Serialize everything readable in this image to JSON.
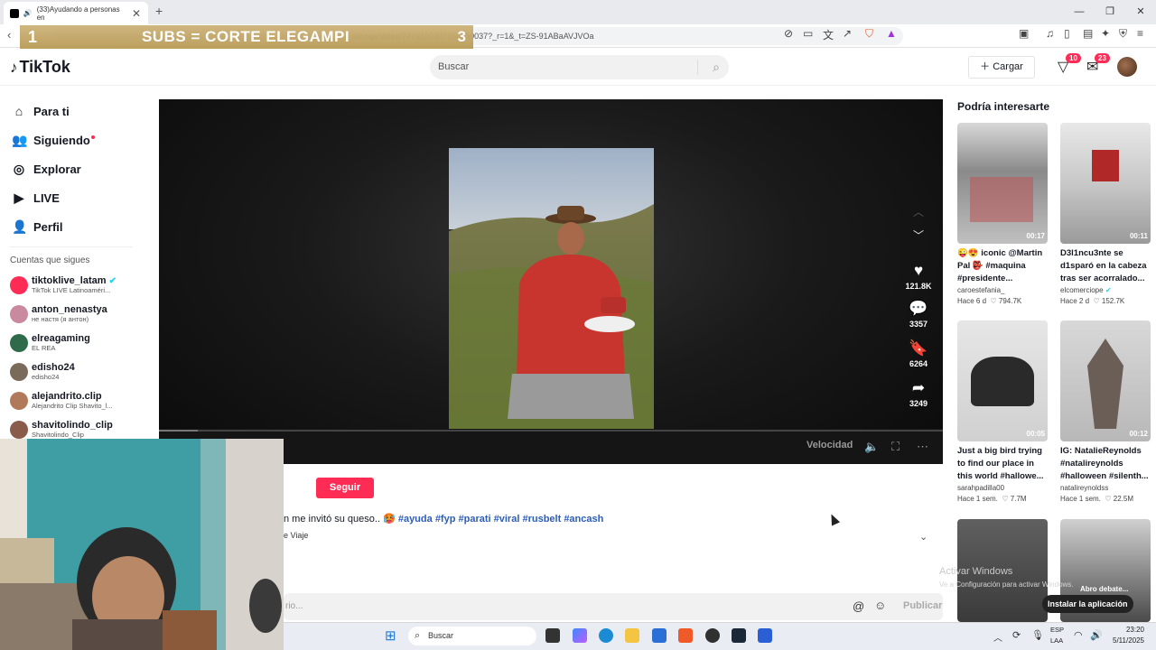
{
  "browser": {
    "tab_title": "(33)Ayudando a personas en",
    "url": "deviaje/video/7479190307366350037?_r=1&_t=ZS-91ABaAVJVOa"
  },
  "overlay": {
    "left": "1",
    "text": "SUBS = CORTE ELEGAMPI",
    "right": "3"
  },
  "header": {
    "logo": "TikTok",
    "search_placeholder": "Buscar",
    "upload_label": "Cargar",
    "inbox_badge": "10",
    "messages_badge": "23"
  },
  "sidebar": {
    "nav": [
      {
        "label": "Para ti",
        "icon": "home-icon"
      },
      {
        "label": "Siguiendo",
        "icon": "following-icon"
      },
      {
        "label": "Explorar",
        "icon": "compass-icon"
      },
      {
        "label": "LIVE",
        "icon": "live-icon"
      },
      {
        "label": "Perfil",
        "icon": "profile-icon"
      }
    ],
    "following_title": "Cuentas que sigues",
    "accounts": [
      {
        "name": "tiktoklive_latam",
        "sub": "TikTok LIVE Latinoaméri..."
      },
      {
        "name": "anton_nenastya",
        "sub": "не настя (я антон)"
      },
      {
        "name": "elreagaming",
        "sub": "EL REA"
      },
      {
        "name": "edisho24",
        "sub": "edisho24"
      },
      {
        "name": "alejandrito.clip",
        "sub": "Alejandrito Clip Shavito_l..."
      },
      {
        "name": "shavitolindo_clip",
        "sub": "Shavitolindo_Clip"
      }
    ]
  },
  "video": {
    "likes": "121.8K",
    "comments": "3357",
    "saves": "6264",
    "shares": "3249",
    "speed_label": "Velocidad",
    "progress": 0.05
  },
  "post": {
    "follow_label": "Seguir",
    "desc_text": "n me invitó su queso.. 🥵",
    "hashtags": [
      "#ayuda",
      "#fyp",
      "#parati",
      "#viral",
      "#rusbelt",
      "#ancash"
    ],
    "music": "e Viaje",
    "comment_placeholder": "rio...",
    "publish_label": "Publicar"
  },
  "recommendations": {
    "title": "Podría interesarte",
    "cards": [
      {
        "title": "😜😍 iconic @Martin Pal 👺 #maquina #presidente...",
        "author": "caroestefania_",
        "age": "Hace 6 d",
        "likes": "794.7K",
        "duration": "00:17"
      },
      {
        "title": "D3l1ncu3nte se d1sparó en la cabeza tras ser acorralado...",
        "author": "elcomerciope",
        "age": "Hace 2 d",
        "likes": "152.7K",
        "duration": "00:11"
      },
      {
        "title": "Just a big bird trying to find our place in this world #hallowe...",
        "author": "sarahpadilla00",
        "age": "Hace 1 sem.",
        "likes": "7.7M",
        "duration": "00:05"
      },
      {
        "title": "IG: NatalieReynolds #natalireynolds #halloween #silenth...",
        "author": "natalireynoldss",
        "age": "Hace 1 sem.",
        "likes": "22.5M",
        "duration": "00:12"
      }
    ],
    "partial_label": "Abro debate..."
  },
  "misc": {
    "activate_title": "Activar Windows",
    "activate_sub": "Ve a Configuración para activar Windows.",
    "install_app": "Instalar la aplicación"
  },
  "taskbar": {
    "search_label": "Buscar",
    "lang_line1": "ESP",
    "lang_line2": "LAA",
    "time": "23:20",
    "date": "5/11/2025"
  }
}
